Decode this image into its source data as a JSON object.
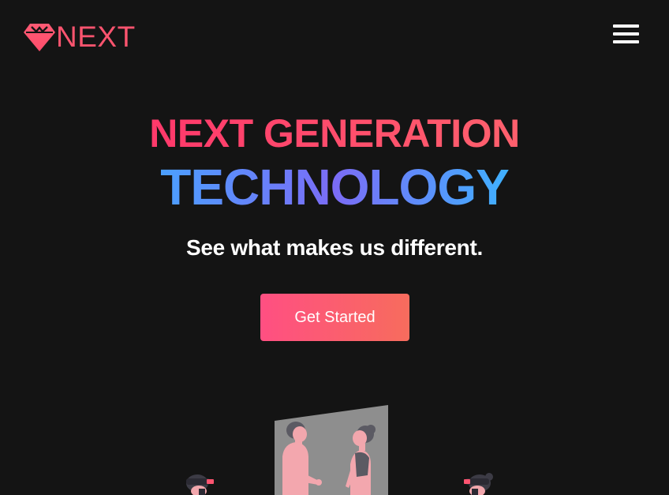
{
  "navbar": {
    "logo_text": "NEXT",
    "menu_icon": "hamburger-menu-icon",
    "logo_icon": "diamond-gem-icon"
  },
  "hero": {
    "heading_line1": "NEXT GENERATION",
    "heading_line2": "TECHNOLOGY",
    "subtitle": "See what makes us different.",
    "cta_label": "Get Started"
  },
  "colors": {
    "background": "#141414",
    "brand_red": "#ff5470",
    "gradient_blue": "#4ba0ff",
    "gradient_purple": "#7b6cf6",
    "button_start": "#ff4f82",
    "button_end": "#f76c5d",
    "illustration_pink": "#f5a9b0",
    "illustration_gray": "#8a8a8a"
  }
}
